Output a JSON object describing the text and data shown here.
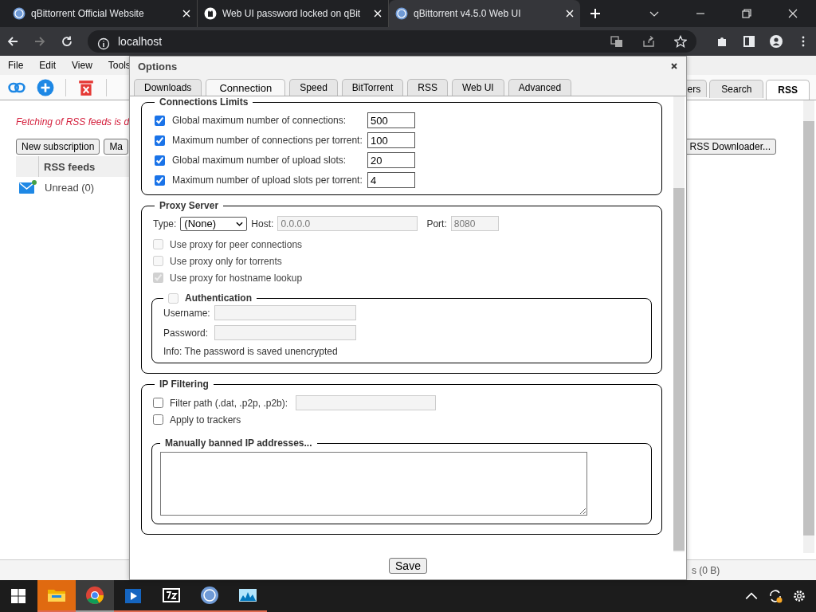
{
  "browser": {
    "tabs": [
      {
        "title": "qBittorrent Official Website",
        "kind": "qb",
        "selected": false
      },
      {
        "title": "Web UI password locked on qBit",
        "kind": "github",
        "selected": false
      },
      {
        "title": "qBittorrent v4.5.0 Web UI",
        "kind": "qb",
        "selected": true
      }
    ],
    "address": "localhost"
  },
  "app": {
    "menu": [
      "File",
      "Edit",
      "View",
      "Tools"
    ],
    "panel_tabs": [
      {
        "label": "ers",
        "selected": false
      },
      {
        "label": "Search",
        "selected": false
      },
      {
        "label": "RSS",
        "selected": true
      }
    ],
    "notice": "Fetching of RSS feeds is d",
    "buttons": [
      "New subscription",
      "Ma"
    ],
    "downloader_button": "RSS Downloader...",
    "feeds_header": "RSS feeds",
    "feeds": [
      {
        "label": "Unread (0)"
      }
    ],
    "status": "s (0 B)"
  },
  "dialog": {
    "title": "Options",
    "tabs": [
      {
        "label": "Downloads",
        "selected": false
      },
      {
        "label": "Connection",
        "selected": true
      },
      {
        "label": "Speed",
        "selected": false
      },
      {
        "label": "BitTorrent",
        "selected": false
      },
      {
        "label": "RSS",
        "selected": false
      },
      {
        "label": "Web UI",
        "selected": false
      },
      {
        "label": "Advanced",
        "selected": false
      }
    ],
    "connection_limits": {
      "legend": "Connections Limits",
      "rows": [
        {
          "label": "Global maximum number of connections:",
          "checked": true,
          "value": "500"
        },
        {
          "label": "Maximum number of connections per torrent:",
          "checked": true,
          "value": "100"
        },
        {
          "label": "Global maximum number of upload slots:",
          "checked": true,
          "value": "20"
        },
        {
          "label": "Maximum number of upload slots per torrent:",
          "checked": true,
          "value": "4"
        }
      ]
    },
    "proxy": {
      "legend": "Proxy Server",
      "type_label": "Type:",
      "type_value": "(None)",
      "host_label": "Host:",
      "host_value": "0.0.0.0",
      "port_label": "Port:",
      "port_value": "8080",
      "options": [
        {
          "label": "Use proxy for peer connections",
          "checked": false,
          "disabled": true
        },
        {
          "label": "Use proxy only for torrents",
          "checked": false,
          "disabled": true
        },
        {
          "label": "Use proxy for hostname lookup",
          "checked": true,
          "disabled": true
        }
      ],
      "auth": {
        "legend": "Authentication",
        "checked": false,
        "disabled": true,
        "username_label": "Username:",
        "password_label": "Password:",
        "info": "Info: The password is saved unencrypted"
      }
    },
    "ip_filtering": {
      "legend": "IP Filtering",
      "options": [
        {
          "kind": "path",
          "label": "Filter path (.dat, .p2p, .p2b):",
          "checked": false
        },
        {
          "kind": "plain",
          "label": "Apply to trackers",
          "checked": false
        }
      ],
      "banned_legend": "Manually banned IP addresses..."
    },
    "save": "Save"
  },
  "taskbar": {
    "apps": [
      {
        "kind": "explorer",
        "selected": false,
        "highlighted": true
      },
      {
        "kind": "chrome",
        "selected": true,
        "highlighted": false
      },
      {
        "kind": "player",
        "selected": false,
        "highlighted": false
      },
      {
        "kind": "sevenzip",
        "selected": false,
        "highlighted": false
      },
      {
        "kind": "qb",
        "selected": false,
        "highlighted": false
      },
      {
        "kind": "monitor",
        "selected": false,
        "highlighted": false
      }
    ]
  }
}
